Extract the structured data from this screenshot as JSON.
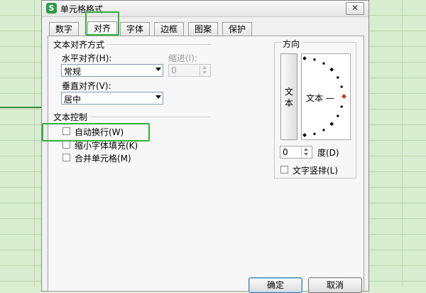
{
  "dialog": {
    "title": "单元格格式",
    "app_icon_glyph": "S",
    "close_glyph": "✕"
  },
  "tabs": [
    {
      "label": "数字",
      "active": false
    },
    {
      "label": "对齐",
      "active": true
    },
    {
      "label": "字体",
      "active": false
    },
    {
      "label": "边框",
      "active": false
    },
    {
      "label": "图案",
      "active": false
    },
    {
      "label": "保护",
      "active": false
    }
  ],
  "text_alignment": {
    "group_label": "文本对齐方式",
    "horizontal_label": "水平对齐(H):",
    "horizontal_value": "常规",
    "indent_label": "缩进(I):",
    "indent_value": "0",
    "vertical_label": "垂直对齐(V):",
    "vertical_value": "居中"
  },
  "text_control": {
    "group_label": "文本控制",
    "wrap_text": {
      "label": "自动换行(W)",
      "checked": false
    },
    "shrink_to_fit": {
      "label": "缩小字体填充(K)",
      "checked": false
    },
    "merge_cells": {
      "label": "合并单元格(M)",
      "checked": false
    }
  },
  "orientation": {
    "group_label": "方向",
    "vertical_text": "文本",
    "dial_text": "文本 —",
    "degree_value": "0",
    "degree_label": "度(D)",
    "vertical_stack": {
      "label": "文字竖排(L)",
      "checked": false
    },
    "dial_dot_color": "#000000",
    "dial_handle_color": "#c0392b"
  },
  "buttons": {
    "ok": "确定",
    "cancel": "取消"
  },
  "colors": {
    "highlight": "#2fb33a",
    "sheet_background": "#d8ecd0"
  }
}
